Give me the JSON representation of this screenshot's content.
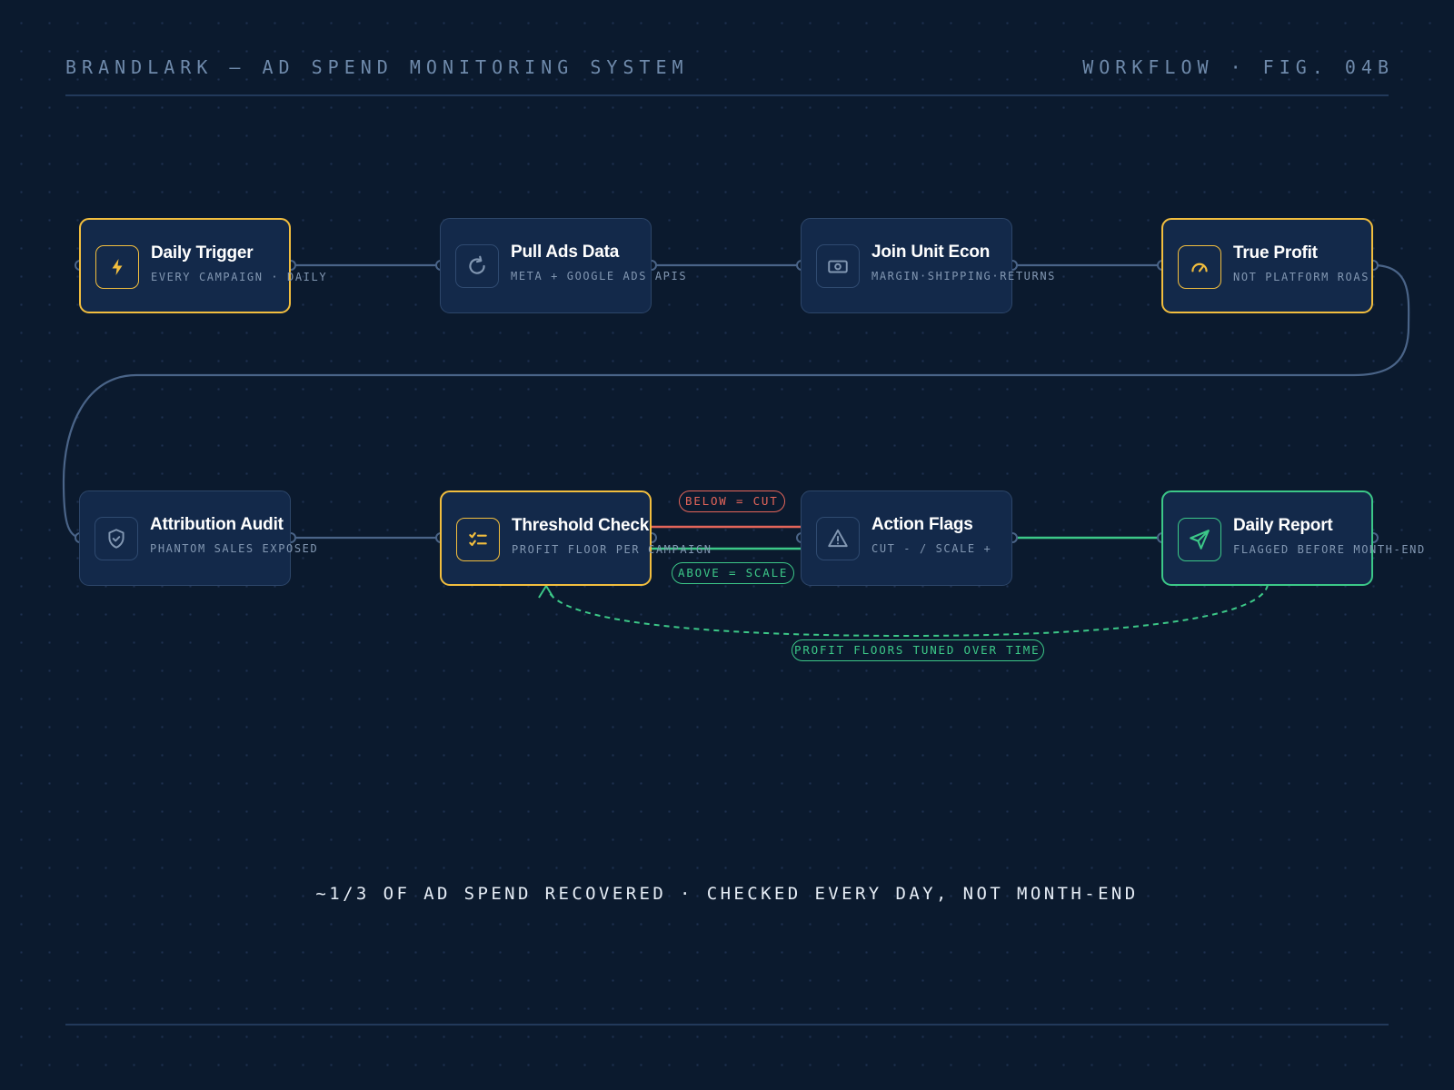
{
  "header": {
    "left": "BRANDLARK — AD SPEND MONITORING SYSTEM",
    "right": "WORKFLOW · FIG. 04B"
  },
  "nodes": [
    {
      "title": "Daily Trigger",
      "subtitle": "EVERY CAMPAIGN · DAILY",
      "icon": "lightning-bolt-icon",
      "accent": "#f2be3e"
    },
    {
      "title": "Pull Ads Data",
      "subtitle": "META + GOOGLE ADS APIS",
      "icon": "refresh-icon",
      "accent": "#2d4669"
    },
    {
      "title": "Join Unit Econ",
      "subtitle": "MARGIN·SHIPPING·RETURNS",
      "icon": "money-bill-icon",
      "accent": "#2d4669"
    },
    {
      "title": "True Profit",
      "subtitle": "NOT PLATFORM ROAS",
      "icon": "gauge-icon",
      "accent": "#f2be3e"
    },
    {
      "title": "Attribution Audit",
      "subtitle": "PHANTOM SALES EXPOSED",
      "icon": "shield-check-icon",
      "accent": "#2d4669"
    },
    {
      "title": "Threshold Check",
      "subtitle": "PROFIT FLOOR PER CAMPAIGN",
      "icon": "checklist-icon",
      "accent": "#f2be3e"
    },
    {
      "title": "Action Flags",
      "subtitle": "CUT - / SCALE +",
      "icon": "warning-triangle-icon",
      "accent": "#2d4669"
    },
    {
      "title": "Daily Report",
      "subtitle": "FLAGGED BEFORE MONTH-END",
      "icon": "send-icon",
      "accent": "#3cc888"
    }
  ],
  "edges": {
    "below_label": "BELOW = CUT",
    "above_label": "ABOVE = SCALE",
    "feedback_label": "PROFIT FLOORS TUNED OVER TIME"
  },
  "footer": {
    "note": "~1/3 OF AD SPEND RECOVERED · CHECKED EVERY DAY, NOT MONTH-END"
  },
  "colors": {
    "background": "#0b1a2e",
    "node_fill": "#13294a",
    "wire": "#4a6488",
    "gold": "#f2be3e",
    "green": "#3cc888",
    "red": "#e4655a"
  }
}
